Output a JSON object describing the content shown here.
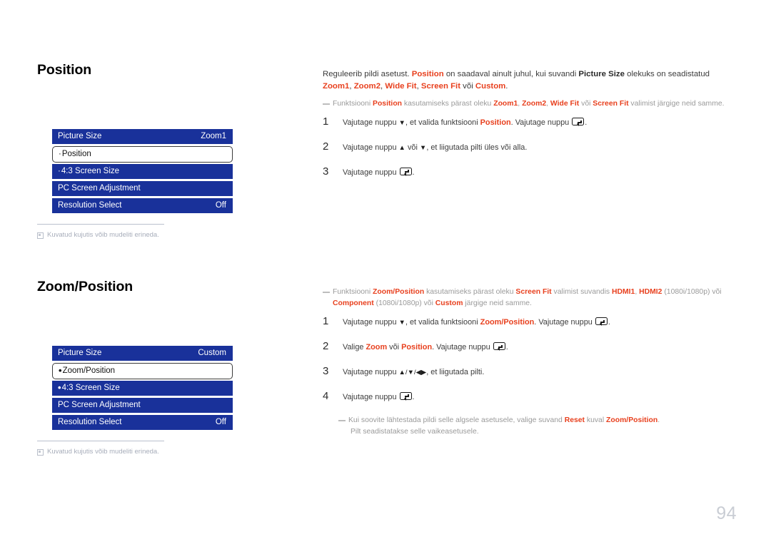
{
  "page": {
    "number": "94"
  },
  "accent": {
    "red": "#e8401e",
    "menu_blue": "#19319a",
    "page_number_gray": "#c9cdd4"
  },
  "sections": [
    {
      "id": "position",
      "heading": "Position",
      "osd": {
        "rows": [
          {
            "marker": "",
            "label": "Picture Size",
            "value": "Zoom1",
            "selected": false
          },
          {
            "marker": "·",
            "label": "Position",
            "value": "",
            "selected": true
          },
          {
            "marker": "·",
            "label": "4:3 Screen Size",
            "value": "",
            "selected": false
          },
          {
            "marker": "",
            "label": "PC Screen Adjustment",
            "value": "",
            "selected": false
          },
          {
            "marker": "",
            "label": "Resolution Select",
            "value": "Off",
            "selected": false
          }
        ],
        "footnote": "Kuvatud kujutis võib mudeliti erineda."
      },
      "intro": {
        "t1": "Reguleerib pildi asetust. ",
        "k1": "Position",
        "t2": " on saadaval ainult juhul, kui suvandi ",
        "k2": "Picture Size",
        "t3": " olekuks on seadistatud ",
        "k3": "Zoom1",
        "t4": ", ",
        "k4": "Zoom2",
        "t5": ", ",
        "k5": "Wide Fit",
        "t6": ", ",
        "k6": "Screen Fit",
        "t7": " või ",
        "k7": "Custom",
        "t8": "."
      },
      "hint": {
        "t1": "Funktsiooni ",
        "k1": "Position",
        "t2": " kasutamiseks pärast oleku ",
        "k2": "Zoom1",
        "t3": ", ",
        "k3": "Zoom2",
        "t4": ", ",
        "k4": "Wide Fit",
        "t5": " või ",
        "k5": "Screen Fit",
        "t6": " valimist järgige neid samme."
      },
      "steps": [
        {
          "num": "1",
          "t1": "Vajutage nuppu ",
          "a1": "▼",
          "t2": ", et valida funktsiooni ",
          "k1": "Position",
          "t3": ". Vajutage nuppu ",
          "t4": "."
        },
        {
          "num": "2",
          "t1": "Vajutage nuppu ",
          "a1": "▲",
          "t2": " või ",
          "a2": "▼",
          "t3": ", et liigutada pilti üles või alla."
        },
        {
          "num": "3",
          "t1": "Vajutage nuppu ",
          "t2": "."
        }
      ]
    },
    {
      "id": "zoomposition",
      "heading": "Zoom/Position",
      "osd": {
        "rows": [
          {
            "marker": "",
            "label": "Picture Size",
            "value": "Custom",
            "selected": false
          },
          {
            "marker": "•",
            "label": "Zoom/Position",
            "value": "",
            "selected": true
          },
          {
            "marker": "•",
            "label": "4:3 Screen Size",
            "value": "",
            "selected": false
          },
          {
            "marker": "",
            "label": "PC Screen Adjustment",
            "value": "",
            "selected": false
          },
          {
            "marker": "",
            "label": "Resolution Select",
            "value": "Off",
            "selected": false
          }
        ],
        "footnote": "Kuvatud kujutis võib mudeliti erineda."
      },
      "hint": {
        "t1": "Funktsiooni ",
        "k1": "Zoom/Position",
        "t2": " kasutamiseks pärast oleku ",
        "k2": "Screen Fit",
        "t3": " valimist suvandis ",
        "k3": "HDMI1",
        "t4": ", ",
        "k4": "HDMI2",
        "t5": " (1080i/1080p) või ",
        "k5": "Component",
        "t6": " (1080i/1080p) või ",
        "k6": "Custom",
        "t7": " järgige neid samme."
      },
      "steps": [
        {
          "num": "1",
          "t1": "Vajutage nuppu ",
          "a1": "▼",
          "t2": ", et valida funktsiooni ",
          "k1": "Zoom/Position",
          "t3": ". Vajutage nuppu ",
          "t4": "."
        },
        {
          "num": "2",
          "t1": "Valige ",
          "k1": "Zoom",
          "t2": " või ",
          "k2": "Position",
          "t3": ". Vajutage nuppu ",
          "t4": "."
        },
        {
          "num": "3",
          "t1": "Vajutage nuppu ",
          "a1": "▲/▼/◀▶",
          "t2": ", et liigutada pilti."
        },
        {
          "num": "4",
          "t1": "Vajutage nuppu ",
          "t2": "."
        }
      ],
      "endnote": {
        "t1": "Kui soovite lähtestada pildi selle algsele asetusele, valige suvand ",
        "k1": "Reset",
        "t2": " kuval ",
        "k2": "Zoom/Position",
        "t3": ".",
        "l2": "Pilt seadistatakse selle vaikeasetusele."
      }
    }
  ]
}
